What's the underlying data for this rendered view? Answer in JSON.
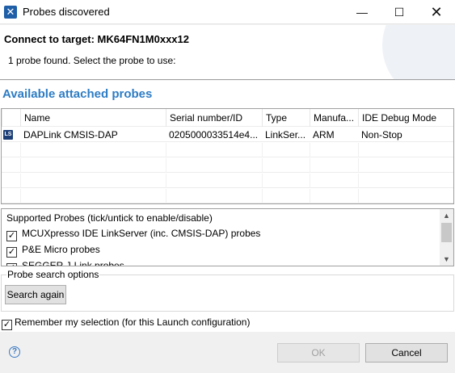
{
  "window": {
    "title": "Probes discovered",
    "icon": "app-x-icon",
    "controls": {
      "minimize": "—",
      "maximize": "☐",
      "close": "✕"
    }
  },
  "banner": {
    "title": "Connect to target: MK64FN1M0xxx12",
    "message": "1 probe found. Select the probe to use:"
  },
  "probes": {
    "section_title": "Available attached probes",
    "columns": [
      "",
      "Name",
      "Serial number/ID",
      "Type",
      "Manufa...",
      "IDE Debug Mode"
    ],
    "rows": [
      {
        "icon": "LS",
        "name": "DAPLink CMSIS-DAP",
        "serial": "0205000033514e4...",
        "type": "LinkSer...",
        "manufacturer": "ARM",
        "debug_mode": "Non-Stop"
      }
    ]
  },
  "supported": {
    "header": "Supported Probes (tick/untick to enable/disable)",
    "items": [
      {
        "label": "MCUXpresso IDE LinkServer (inc. CMSIS-DAP) probes",
        "checked": true
      },
      {
        "label": "P&E Micro probes",
        "checked": true
      },
      {
        "label": "SEGGER J-Link probes",
        "checked": true
      }
    ]
  },
  "search_options": {
    "legend": "Probe search options",
    "button": "Search again"
  },
  "remember": {
    "label": "Remember my selection (for this Launch configuration)",
    "checked": true
  },
  "footer": {
    "help": "?",
    "ok": "OK",
    "cancel": "Cancel"
  },
  "colors": {
    "accent": "#2d7cc4",
    "border": "#a0a0a0"
  }
}
